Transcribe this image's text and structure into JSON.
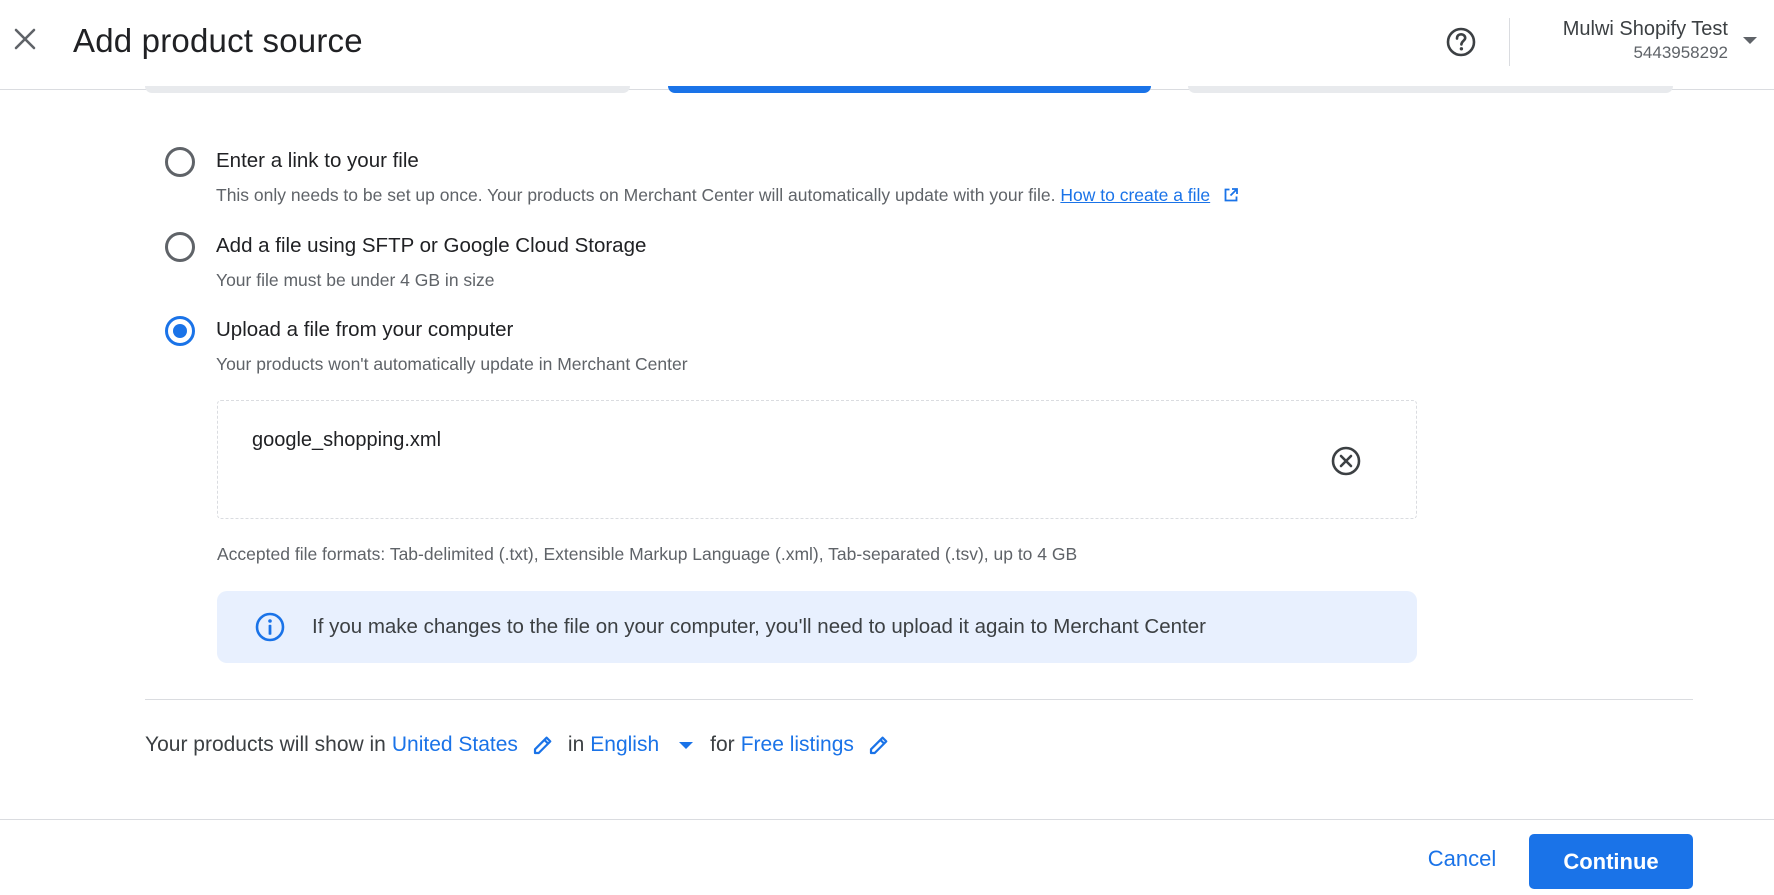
{
  "header": {
    "title": "Add product source",
    "account_name": "Mulwi Shopify Test",
    "account_id": "5443958292",
    "close_icon": "close-icon",
    "help_icon": "help-circle-icon"
  },
  "options": [
    {
      "title": "Enter a link to your file",
      "description": "This only needs to be set up once. Your products on Merchant Center will automatically update with your file.",
      "link_text": "How to create a file",
      "selected": false
    },
    {
      "title": "Add a file using SFTP or Google Cloud Storage",
      "description": "Your file must be under 4 GB in size",
      "selected": false
    },
    {
      "title": "Upload a file from your computer",
      "description": "Your products won't automatically update in Merchant Center",
      "selected": true
    }
  ],
  "upload": {
    "file_name": "google_shopping.xml",
    "accepted_formats": "Accepted file formats: Tab-delimited (.txt), Extensible Markup Language (.xml), Tab-separated (.tsv), up to 4 GB",
    "info_message": "If you make changes to the file on your computer, you'll need to upload it again to Merchant Center"
  },
  "target": {
    "prefix": "Your products will show in",
    "country": "United States",
    "in_word": "in",
    "language": "English",
    "for_word": "for",
    "destination": "Free listings"
  },
  "footer": {
    "cancel_label": "Cancel",
    "continue_label": "Continue"
  },
  "colors": {
    "accent": "#1a73e8",
    "info_bg": "#e8f0fe",
    "text": "#3c4043",
    "muted": "#5f6368"
  }
}
